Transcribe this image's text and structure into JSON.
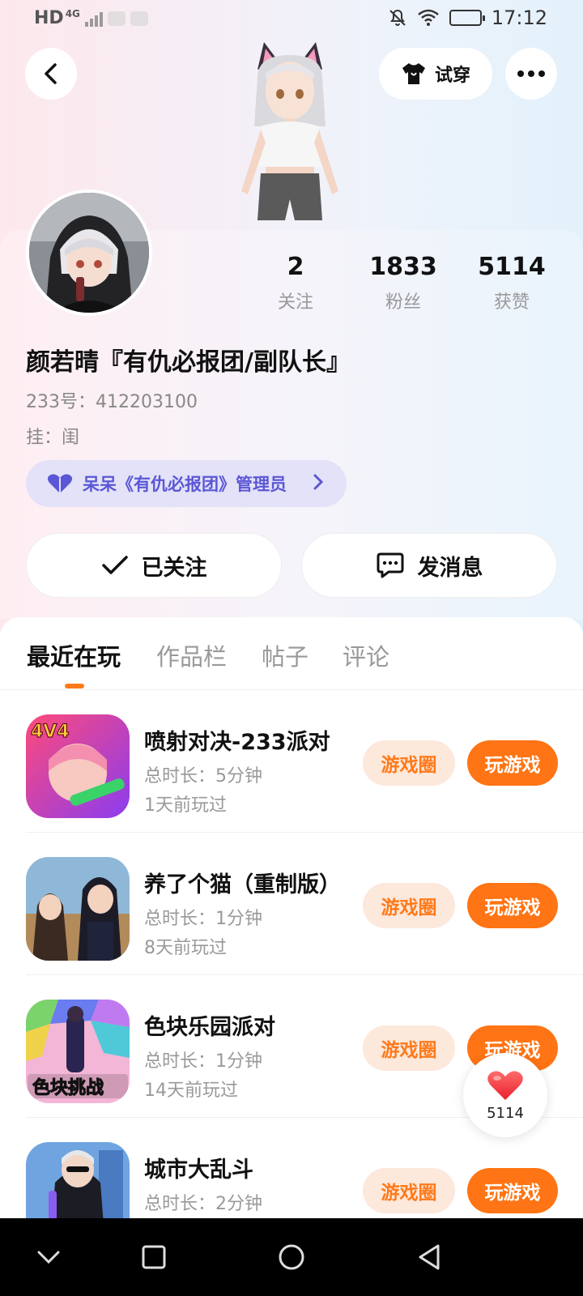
{
  "status_bar": {
    "network_hd": "HD",
    "network_4g": "4G",
    "time": "17:12"
  },
  "header": {
    "tryon_label": "试穿"
  },
  "profile": {
    "stats": [
      {
        "value": "2",
        "label": "关注"
      },
      {
        "value": "1833",
        "label": "粉丝"
      },
      {
        "value": "5114",
        "label": "获赞"
      }
    ],
    "nickname": "颜若晴『有仇必报团/副队长』",
    "uid": "233号：412203100",
    "hang": "挂：闺",
    "role_badge": "呆呆《有仇必报团》管理员",
    "follow_button": "已关注",
    "message_button": "发消息"
  },
  "tabs": [
    {
      "label": "最近在玩",
      "active": true
    },
    {
      "label": "作品栏",
      "active": false
    },
    {
      "label": "帖子",
      "active": false
    },
    {
      "label": "评论",
      "active": false
    }
  ],
  "games": [
    {
      "title": "喷射对决-233派对",
      "duration": "总时长：5分钟",
      "last_played": "1天前玩过",
      "icon_text": "4V4",
      "circle_label": "游戏圈",
      "play_label": "玩游戏"
    },
    {
      "title": "养了个猫（重制版）",
      "duration": "总时长：1分钟",
      "last_played": "8天前玩过",
      "icon_text": "",
      "circle_label": "游戏圈",
      "play_label": "玩游戏"
    },
    {
      "title": "色块乐园派对",
      "duration": "总时长：1分钟",
      "last_played": "14天前玩过",
      "icon_text": "色块挑战",
      "circle_label": "游戏圈",
      "play_label": "玩游戏"
    },
    {
      "title": "城市大乱斗",
      "duration": "总时长：2分钟",
      "last_played": "",
      "icon_text": "",
      "circle_label": "游戏圈",
      "play_label": "玩游戏"
    }
  ],
  "like_fab": {
    "count": "5114"
  },
  "colors": {
    "accent": "#ff7414",
    "accent_soft": "#fde8dc",
    "role_bg": "#e3e2f8",
    "role_text": "#5b57d6",
    "like_red": "#ff3b4a"
  }
}
